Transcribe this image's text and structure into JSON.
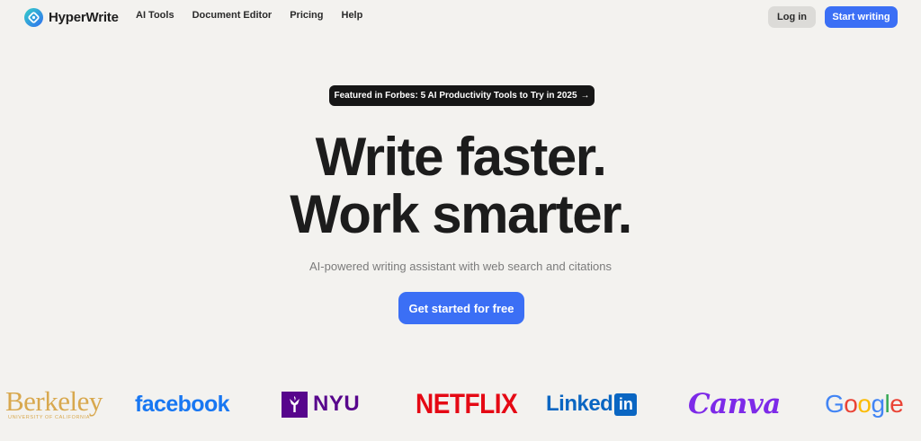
{
  "nav": {
    "brand": "HyperWrite",
    "links": [
      "AI Tools",
      "Document Editor",
      "Pricing",
      "Help"
    ],
    "login_label": "Log in",
    "start_label": "Start writing"
  },
  "hero": {
    "badge_text": "Featured in Forbes: 5 AI Productivity Tools to Try in 2025",
    "badge_arrow": "→",
    "title_line1": "Write faster.",
    "title_line2": "Work smarter.",
    "subtitle": "AI-powered writing assistant with web search and citations",
    "cta_label": "Get started for free"
  },
  "logos": {
    "berkeley": "Berkeley",
    "berkeley_sub": "UNIVERSITY OF CALIFORNIA",
    "facebook": "facebook",
    "nyu": "NYU",
    "netflix": "NETFLIX",
    "linkedin_text": "Linked",
    "linkedin_box": "in",
    "canva": "Canva",
    "google": [
      "G",
      "o",
      "o",
      "g",
      "l",
      "e"
    ]
  },
  "colors": {
    "background": "#f3f2ef",
    "accent": "#3b6ff5",
    "badge_bg": "#161616",
    "facebook": "#1877f2",
    "nyu": "#57068c",
    "netflix": "#e50914",
    "linkedin": "#0a66c2",
    "canva": "#7d2ae8",
    "berkeley": "#d8a84e"
  },
  "icons": {
    "brand_logo": "hyperwrite-logo-icon",
    "badge_arrow": "arrow-right-icon",
    "nyu_torch": "nyu-torch-icon"
  }
}
